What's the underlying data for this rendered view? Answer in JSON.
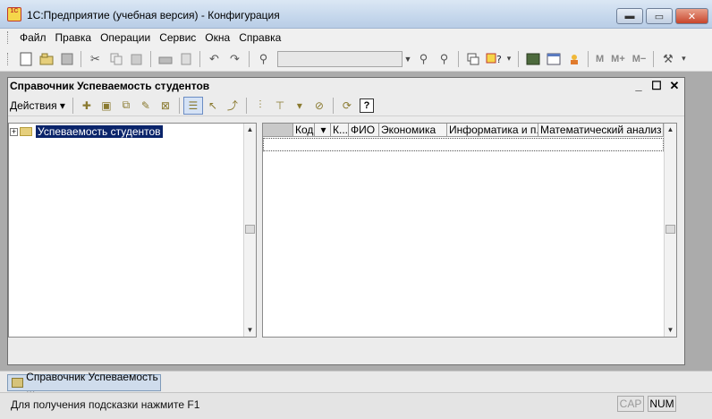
{
  "window": {
    "app_icon": "1C",
    "title": "1С:Предприятие (учебная версия) - Конфигурация",
    "min": "▬",
    "max": "▭",
    "close": "✕"
  },
  "menu": [
    {
      "label": "Файл"
    },
    {
      "label": "Правка"
    },
    {
      "label": "Операции"
    },
    {
      "label": "Сервис"
    },
    {
      "label": "Окна"
    },
    {
      "label": "Справка"
    }
  ],
  "toolbar": {
    "search_value": "",
    "m": "M",
    "m_plus": "M+",
    "m_minus": "M−"
  },
  "child": {
    "title": "Справочник Успеваемость студентов",
    "minimize": "_",
    "restore": "☐",
    "close": "✕",
    "actions_label": "Действия ▾",
    "help_label": "?"
  },
  "tree": {
    "root_label": "Успеваемость студентов"
  },
  "list": {
    "columns": [
      "",
      "Код",
      "▾",
      "К...",
      "ФИО",
      "Экономика",
      "Информатика и п...",
      "Математический анализ"
    ]
  },
  "taskbar": {
    "item_label": "Справочник Успеваемость ..."
  },
  "status": {
    "hint": "Для получения подсказки нажмите F1",
    "cap": "CAP",
    "num": "NUM"
  }
}
